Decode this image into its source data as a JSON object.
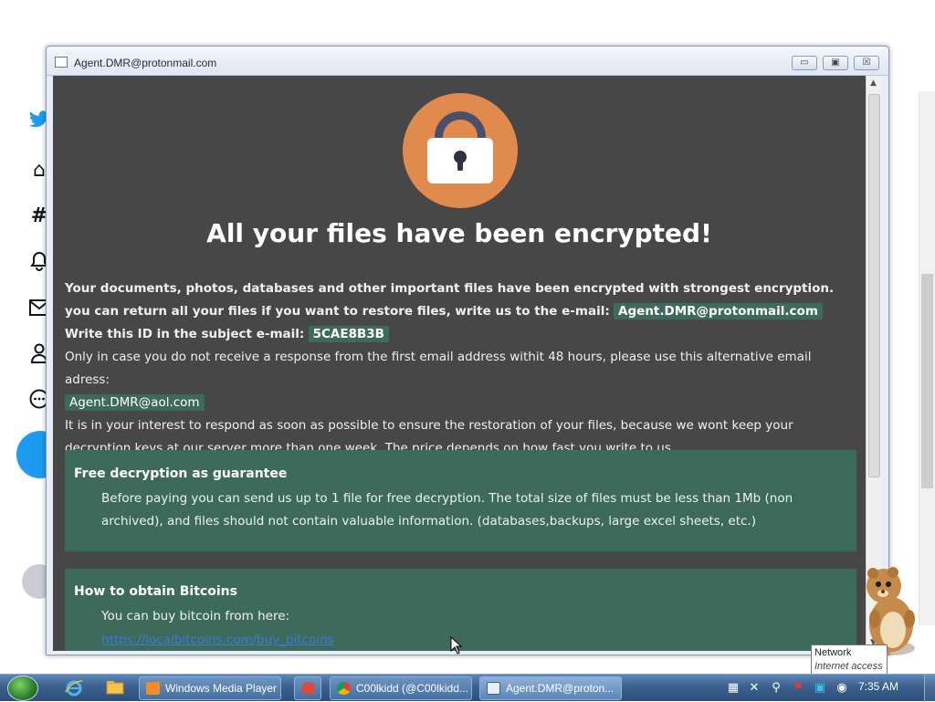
{
  "window": {
    "title": "Agent.DMR@protonmail.com",
    "minimize_glyph": "▭",
    "maximize_glyph": "▣",
    "close_glyph": "☒"
  },
  "ransom": {
    "headline": "All your files have been encrypted!",
    "intro_bold_1": "Your documents, photos, databases and other important files have been encrypted with strongest encryption. you can return all your files if you want to restore files, write us to the e-mail:",
    "primary_email": "Agent.DMR@protonmail.com",
    "id_label": "Write this ID in the subject e-mail:",
    "id_value": "5CAE8B3B",
    "alt_text": "Only in case you do not receive a response from the first email address withit 48 hours, please use this alternative email adress:",
    "alt_email": "Agent.DMR@aol.com",
    "warning_text": "It is in your interest to respond as soon as possible to ensure the restoration of your files, because we wont keep your decryption keys at our server more than one week. The price depends on how fast you write to us.",
    "panels": [
      {
        "title": "Free decryption as guarantee",
        "body": "Before paying you can send us up to 1 file for free decryption. The total size of files must be less than 1Mb (non archived), and files should not contain valuable information. (databases,backups, large excel sheets, etc.)"
      },
      {
        "title": "How to obtain Bitcoins",
        "body": "You can buy bitcoin from here:",
        "link": "https://localbitcoins.com/buy_bitcoins"
      }
    ]
  },
  "tooltip": {
    "title": "Network",
    "subtitle": "Internet access"
  },
  "taskbar": {
    "tasks": [
      {
        "label": "Windows Media Player"
      },
      {
        "label": "C00lkidd (@C00lkidd..."
      },
      {
        "label": "Agent.DMR@proton..."
      }
    ],
    "clock": "7:35 AM"
  },
  "background_browser": {
    "icons": [
      "twitter-bird-icon",
      "home-icon",
      "hashtag-icon",
      "bell-icon",
      "mail-icon",
      "profile-icon",
      "more-icon"
    ]
  },
  "colors": {
    "window_bg": "#474747",
    "panel_bg": "#3e6a5c",
    "lock_circle": "#e08a4e",
    "link": "#3a7bd5",
    "twitter_blue": "#1d9bf0"
  }
}
